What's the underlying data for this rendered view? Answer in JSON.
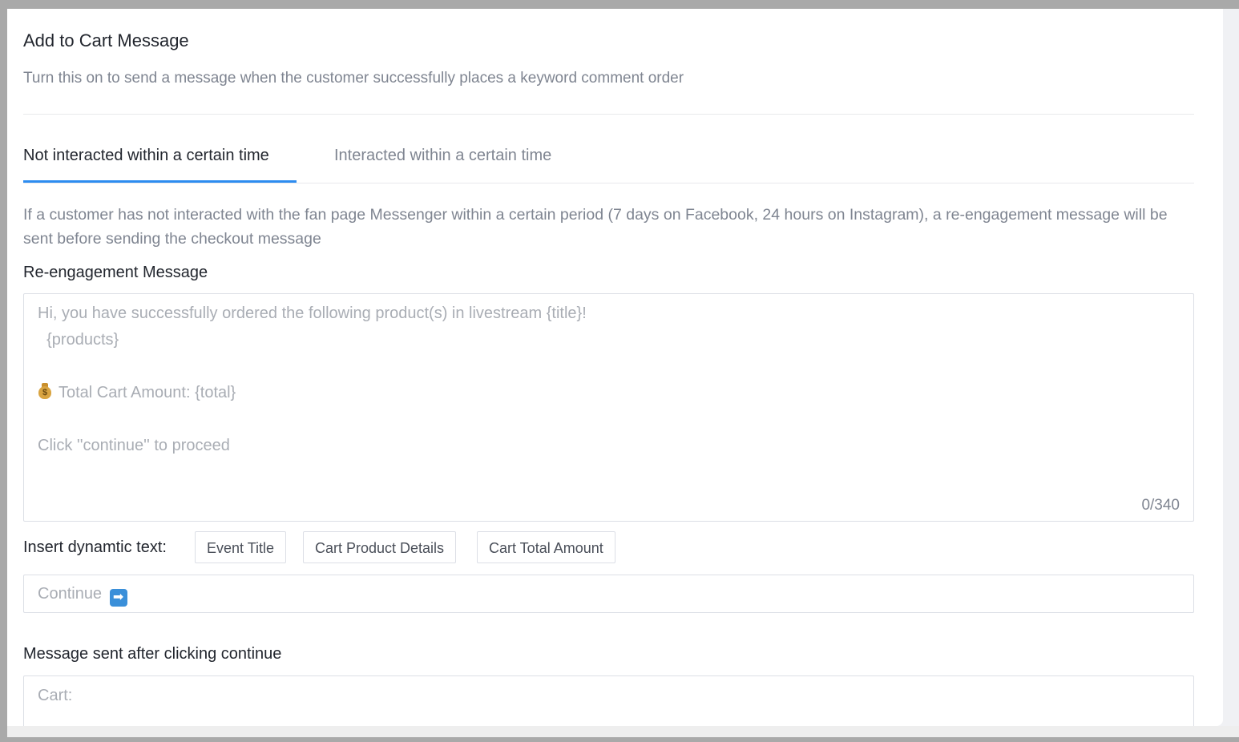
{
  "header": {
    "title": "Add to Cart Message",
    "subtitle": "Turn this on to send a message when the customer successfully places a keyword comment order"
  },
  "tabs": [
    {
      "label": "Not interacted within a certain time",
      "active": true
    },
    {
      "label": "Interacted within a certain time",
      "active": false
    }
  ],
  "info_text": "If a customer has not interacted with the fan page Messenger within a certain period (7 days on Facebook, 24 hours on Instagram), a re-engagement message will be sent before sending the checkout message",
  "reengagement": {
    "label": "Re-engagement Message",
    "placeholder_lines": [
      "Hi, you have successfully ordered the following product(s) in livestream {title}!",
      "  {products}",
      "",
      "Total Cart Amount: {total}",
      "",
      "Click ''continue'' to proceed"
    ],
    "money_icon": "money-bag-icon",
    "counter": "0/340"
  },
  "insert_dynamic": {
    "label": "Insert dynamtic text:",
    "chips": [
      "Event Title",
      "Cart Product Details",
      "Cart Total Amount"
    ]
  },
  "continue_input": {
    "placeholder": "Continue",
    "icon": "right-arrow-icon",
    "icon_glyph": "➡"
  },
  "after_continue": {
    "label": "Message sent after clicking continue",
    "placeholder": "Cart:"
  },
  "colors": {
    "accent": "#2d8cf0",
    "text_primary": "#22262e",
    "text_secondary": "#7f8591",
    "placeholder": "#a9adb4"
  }
}
